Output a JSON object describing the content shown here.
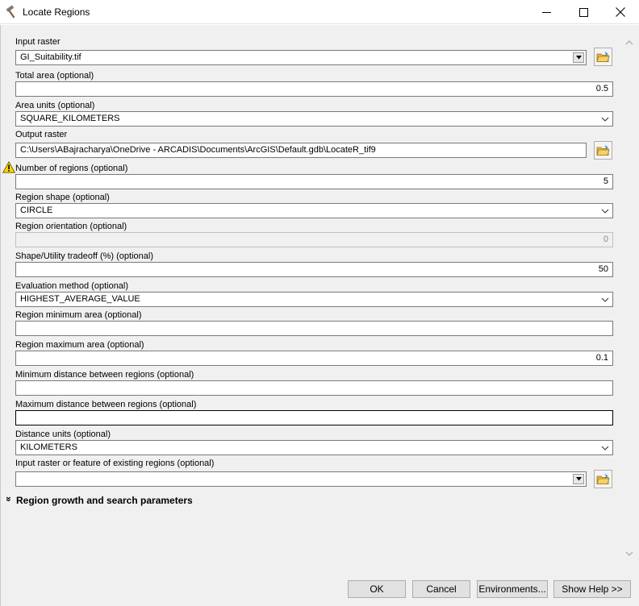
{
  "window": {
    "title": "Locate Regions",
    "icon": "hammer-icon"
  },
  "fields": [
    {
      "label": "Input raster",
      "value": "GI_Suitability.tif",
      "type": "combo-browse"
    },
    {
      "label": "Total area (optional)",
      "value": "0.5",
      "type": "number"
    },
    {
      "label": "Area units (optional)",
      "value": "SQUARE_KILOMETERS",
      "type": "dropdown"
    },
    {
      "label": "Output raster",
      "value": "C:\\Users\\ABajracharya\\OneDrive - ARCADIS\\Documents\\ArcGIS\\Default.gdb\\LocateR_tif9",
      "type": "text-browse"
    },
    {
      "label": "Number of regions (optional)",
      "value": "5",
      "type": "number",
      "warning": true
    },
    {
      "label": "Region shape (optional)",
      "value": "CIRCLE",
      "type": "dropdown"
    },
    {
      "label": "Region orientation (optional)",
      "value": "0",
      "type": "number",
      "disabled": true
    },
    {
      "label": "Shape/Utility tradeoff (%) (optional)",
      "value": "50",
      "type": "number"
    },
    {
      "label": "Evaluation method (optional)",
      "value": "HIGHEST_AVERAGE_VALUE",
      "type": "dropdown"
    },
    {
      "label": "Region minimum area (optional)",
      "value": "",
      "type": "number"
    },
    {
      "label": "Region maximum area (optional)",
      "value": "0.1",
      "type": "number"
    },
    {
      "label": "Minimum distance between regions (optional)",
      "value": "",
      "type": "number"
    },
    {
      "label": "Maximum distance between regions (optional)",
      "value": "",
      "type": "number"
    },
    {
      "label": "Distance units (optional)",
      "value": "KILOMETERS",
      "type": "dropdown"
    },
    {
      "label": "Input raster or feature of existing regions (optional)",
      "value": "",
      "type": "combo-browse"
    }
  ],
  "section": {
    "label": "Region growth and search parameters",
    "chevron": "»"
  },
  "buttons": {
    "ok": "OK",
    "cancel": "Cancel",
    "environments": "Environments...",
    "help": "Show Help >>"
  },
  "icons": {
    "folder": "open-folder-icon",
    "warning": "warning-icon"
  },
  "colors": {
    "panel_bg": "#f0f0f0",
    "warning_yellow": "#f5d400",
    "folder_yellow": "#e8b83a"
  }
}
